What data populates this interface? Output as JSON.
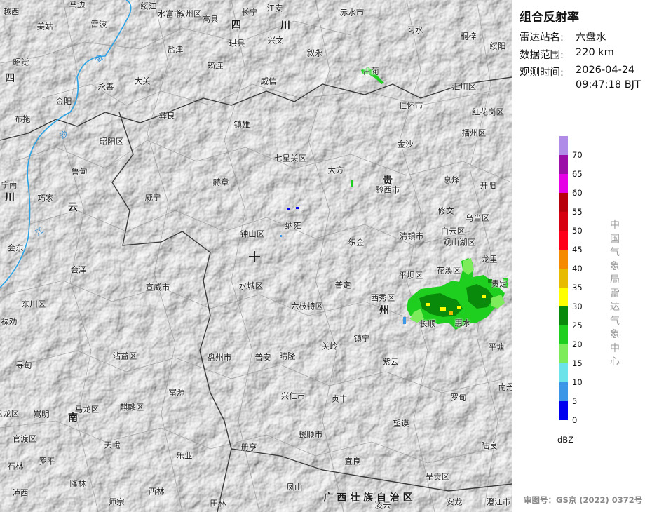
{
  "panel": {
    "title": "组合反射率",
    "station_label": "雷达站名:",
    "station_value": "六盘水",
    "range_label": "数据范围:",
    "range_value": "220 km",
    "time_label": "观测时间:",
    "time_date": "2026-04-24",
    "time_clock": "09:47:18 BJT",
    "organization": "中国气象局雷达气象中心",
    "approval": "审图号：GS京 (2022) 0372号"
  },
  "legend": {
    "unit": "dBZ",
    "colors": [
      "#b08ce8",
      "#9b0fa8",
      "#e600e6",
      "#b8000d",
      "#d60010",
      "#ff0018",
      "#f58a00",
      "#e6bb00",
      "#ffff00",
      "#0a8a0a",
      "#1fcf1f",
      "#7cec5a",
      "#6be3e8",
      "#3c96e8",
      "#0000f0"
    ],
    "ticks": [
      "70",
      "65",
      "60",
      "55",
      "50",
      "45",
      "40",
      "35",
      "30",
      "25",
      "20",
      "15",
      "10",
      "5",
      "0"
    ]
  },
  "map": {
    "provinces": [
      {
        "id": "sichuan-1",
        "text": "四"
      },
      {
        "id": "sichuan-2",
        "text": "川"
      },
      {
        "id": "sichuan-w1",
        "text": "四"
      },
      {
        "id": "sichuan-w2",
        "text": "川"
      },
      {
        "id": "yunnan",
        "text": "云"
      },
      {
        "id": "yunnan-s",
        "text": "南"
      },
      {
        "id": "guizhou-1",
        "text": "贵"
      },
      {
        "id": "guizhou-2",
        "text": "州"
      },
      {
        "id": "guangxi",
        "text": "广  西  壮  族  自  治  区"
      }
    ],
    "cities": [
      "越西",
      "马边",
      "绥江",
      "水富市",
      "叙州区",
      "高县",
      "长宁",
      "江安",
      "赤水市",
      "美姑",
      "雷波",
      "盐津",
      "珙县",
      "兴文",
      "习水",
      "桐梓",
      "昭觉",
      "大关",
      "筠连",
      "叙永",
      "古蔺",
      "绥阳",
      "四",
      "永善",
      "威信",
      "汇川区",
      "金阳",
      "彝良",
      "镇雄",
      "仁怀市",
      "红花岗区",
      "布拖",
      "昭阳区",
      "播州区",
      "金沙",
      "鲁甸",
      "七星关区",
      "大方",
      "息烽",
      "宁南",
      "巧家",
      "赫章",
      "黔西市",
      "开阳",
      "川",
      "威宁",
      "修文",
      "乌当区",
      "会东",
      "钟山区",
      "纳雍",
      "清镇市",
      "白云区",
      "观山湖区",
      "会泽",
      "织金",
      "花溪区",
      "龙里",
      "平坝区",
      "贵定",
      "宣威市",
      "水城区",
      "普定",
      "西秀区",
      "东川区",
      "六枝特区",
      "长顺",
      "惠水",
      "禄劝",
      "关岭",
      "镇宁",
      "平塘",
      "寻甸",
      "沾益区",
      "盘州市",
      "普安",
      "晴隆",
      "紫云",
      "富源",
      "兴仁市",
      "贞丰",
      "罗甸",
      "马龙区",
      "麒麟区",
      "南丹",
      "盘龙区",
      "嵩明",
      "望谟",
      "官渡区",
      "天峨",
      "陆良",
      "兴义市",
      "册亨",
      "宜良",
      "罗平",
      "乐业",
      "呈贡区",
      "石林",
      "隆林",
      "凤山",
      "澄江市",
      "泸西",
      "师宗",
      "西林",
      "田林",
      "凌云",
      "安龙",
      "长顺"
    ],
    "rivers": [
      "金",
      "沙",
      "江"
    ],
    "marker": "radar-site"
  }
}
